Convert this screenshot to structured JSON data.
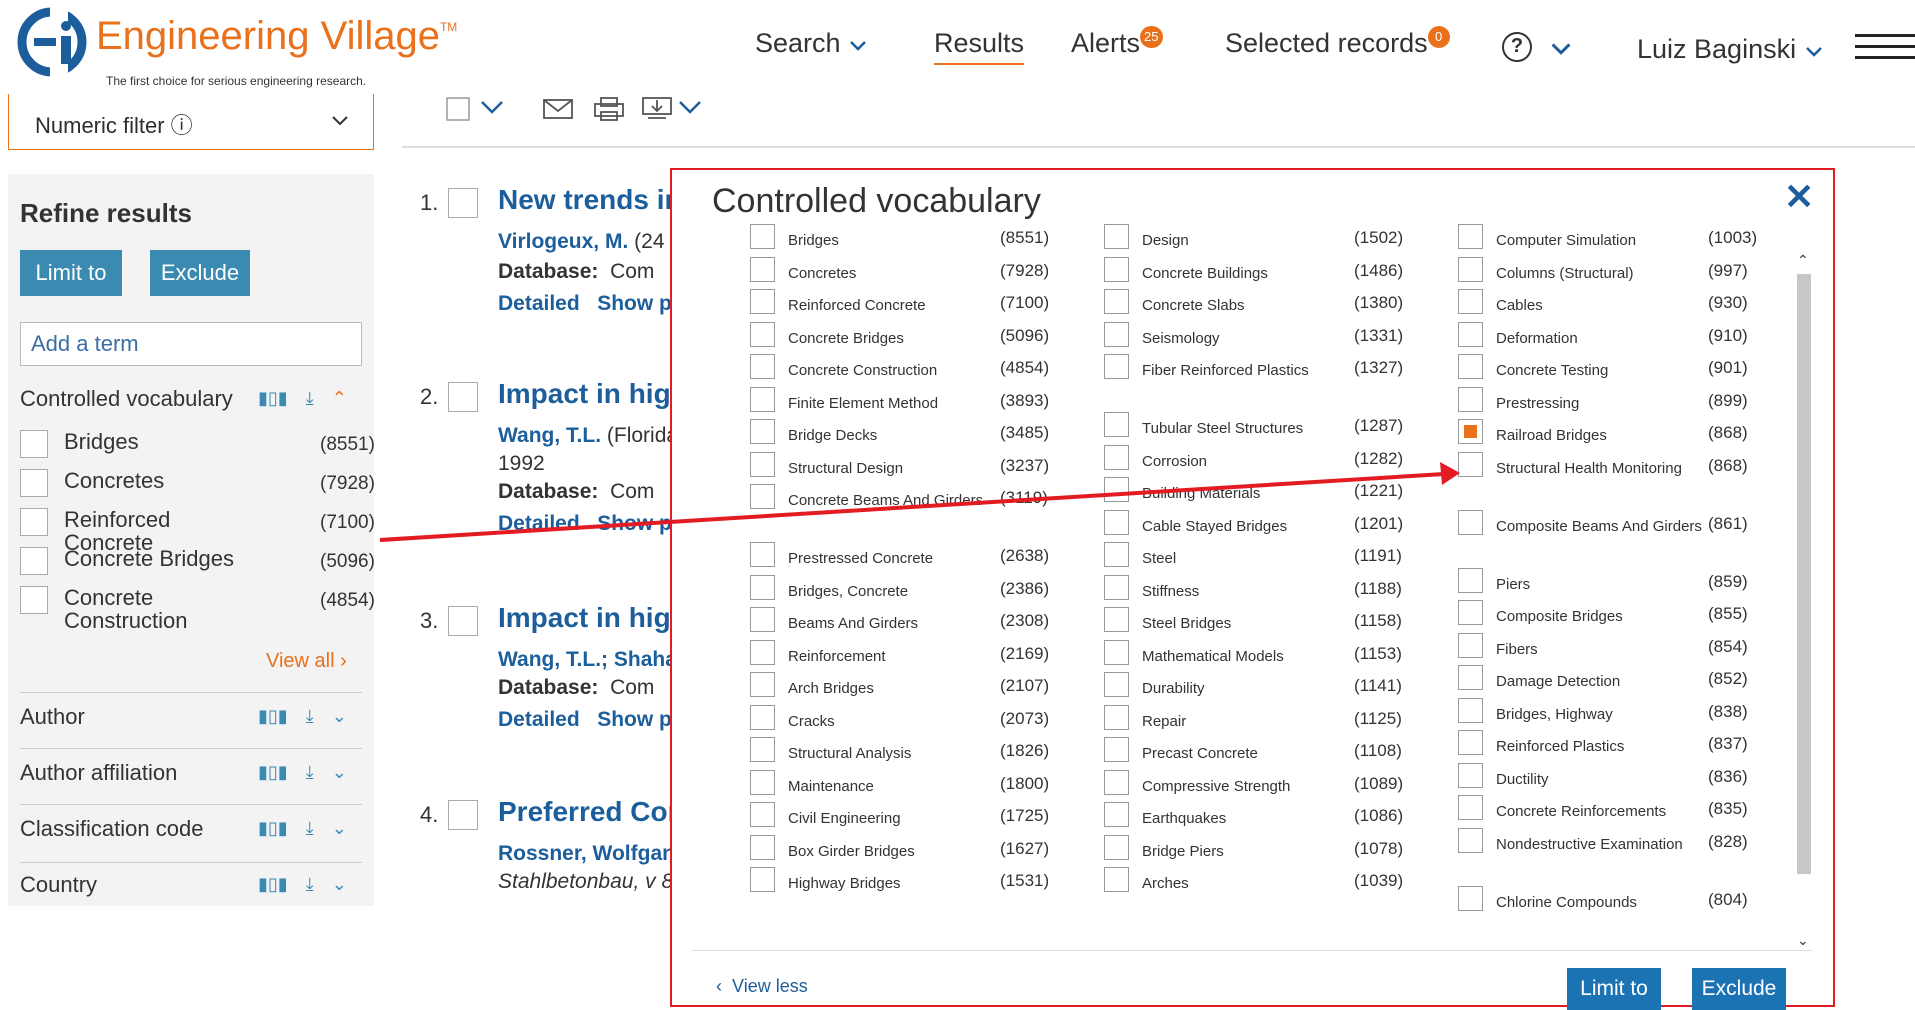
{
  "header": {
    "logo_title": "Engineering Village",
    "logo_tm": "TM",
    "logo_tagline": "The first choice for serious engineering research.",
    "nav_search": "Search",
    "nav_results": "Results",
    "nav_alerts": "Alerts",
    "alerts_badge": "25",
    "nav_selected": "Selected records",
    "selected_badge": "0",
    "help_symbol": "?",
    "user_name": "Luiz Baginski",
    "accent_color": "#e9711c"
  },
  "sidebar": {
    "numeric_filter": "Numeric filter ⓘ",
    "refine_title": "Refine results",
    "limit_label": "Limit to",
    "exclude_label": "Exclude",
    "add_term_placeholder": "Add a term",
    "controlled_vocab_label": "Controlled vocabulary",
    "items": [
      {
        "label": "Bridges",
        "count": "(8551)"
      },
      {
        "label": "Concretes",
        "count": "(7928)"
      },
      {
        "label": "Reinforced Concrete",
        "count": "(7100)"
      },
      {
        "label": "Concrete Bridges",
        "count": "(5096)"
      },
      {
        "label": "Concrete Construction",
        "count": "(4854)"
      }
    ],
    "view_all": "View all",
    "facets": [
      "Author",
      "Author affiliation",
      "Classification code",
      "Country"
    ]
  },
  "results": [
    {
      "num": "1.",
      "title": "New trends in",
      "line1_author": "Virlogeux, M.",
      "line1_rest": " (24",
      "db_label": "Database:",
      "db_value": "Com",
      "link1": "Detailed",
      "link2": "Show p"
    },
    {
      "num": "2.",
      "title": "Impact in high",
      "line1_author": "Wang, T.L.",
      "line1_rest": " (Florida",
      "year": "1992",
      "db_label": "Database:",
      "db_value": "Com",
      "link1": "Detailed",
      "link2": "Show p"
    },
    {
      "num": "3.",
      "title": "Impact in high",
      "line1_author": "Wang, T.L.; Shaha",
      "db_label": "Database:",
      "db_value": "Com",
      "link1": "Detailed",
      "link2": "Show p"
    },
    {
      "num": "4.",
      "title": "Preferred Con",
      "line1_author": "Rossner, Wolfgan",
      "line2": "Stahlbetonbau, v 8"
    }
  ],
  "modal": {
    "title": "Controlled vocabulary",
    "close": "✕",
    "view_less": "View less",
    "limit_label": "Limit to",
    "exclude_label": "Exclude",
    "col1": [
      {
        "label": "Bridges",
        "count": "(8551)"
      },
      {
        "label": "Concretes",
        "count": "(7928)"
      },
      {
        "label": "Reinforced Concrete",
        "count": "(7100)"
      },
      {
        "label": "Concrete Bridges",
        "count": "(5096)"
      },
      {
        "label": "Concrete Construction",
        "count": "(4854)"
      },
      {
        "label": "Finite Element Method",
        "count": "(3893)"
      },
      {
        "label": "Bridge Decks",
        "count": "(3485)"
      },
      {
        "label": "Structural Design",
        "count": "(3237)"
      },
      {
        "label": "Concrete Beams And Girders",
        "count": "(3119)"
      },
      {
        "label": "Prestressed Concrete",
        "count": "(2638)"
      },
      {
        "label": "Bridges, Concrete",
        "count": "(2386)"
      },
      {
        "label": "Beams And Girders",
        "count": "(2308)"
      },
      {
        "label": "Reinforcement",
        "count": "(2169)"
      },
      {
        "label": "Arch Bridges",
        "count": "(2107)"
      },
      {
        "label": "Cracks",
        "count": "(2073)"
      },
      {
        "label": "Structural Analysis",
        "count": "(1826)"
      },
      {
        "label": "Maintenance",
        "count": "(1800)"
      },
      {
        "label": "Civil Engineering",
        "count": "(1725)"
      },
      {
        "label": "Box Girder Bridges",
        "count": "(1627)"
      },
      {
        "label": "Highway Bridges",
        "count": "(1531)"
      }
    ],
    "col2": [
      {
        "label": "Design",
        "count": "(1502)"
      },
      {
        "label": "Concrete Buildings",
        "count": "(1486)"
      },
      {
        "label": "Concrete Slabs",
        "count": "(1380)"
      },
      {
        "label": "Seismology",
        "count": "(1331)"
      },
      {
        "label": "Fiber Reinforced Plastics",
        "count": "(1327)"
      },
      {
        "label": "Tubular Steel Structures",
        "count": "(1287)"
      },
      {
        "label": "Corrosion",
        "count": "(1282)"
      },
      {
        "label": "Building Materials",
        "count": "(1221)"
      },
      {
        "label": "Cable Stayed Bridges",
        "count": "(1201)"
      },
      {
        "label": "Steel",
        "count": "(1191)"
      },
      {
        "label": "Stiffness",
        "count": "(1188)"
      },
      {
        "label": "Steel Bridges",
        "count": "(1158)"
      },
      {
        "label": "Mathematical Models",
        "count": "(1153)"
      },
      {
        "label": "Durability",
        "count": "(1141)"
      },
      {
        "label": "Repair",
        "count": "(1125)"
      },
      {
        "label": "Precast Concrete",
        "count": "(1108)"
      },
      {
        "label": "Compressive Strength",
        "count": "(1089)"
      },
      {
        "label": "Earthquakes",
        "count": "(1086)"
      },
      {
        "label": "Bridge Piers",
        "count": "(1078)"
      },
      {
        "label": "Arches",
        "count": "(1039)"
      }
    ],
    "col3": [
      {
        "label": "Computer Simulation",
        "count": "(1003)"
      },
      {
        "label": "Columns (Structural)",
        "count": "(997)"
      },
      {
        "label": "Cables",
        "count": "(930)"
      },
      {
        "label": "Deformation",
        "count": "(910)"
      },
      {
        "label": "Concrete Testing",
        "count": "(901)"
      },
      {
        "label": "Prestressing",
        "count": "(899)"
      },
      {
        "label": "Railroad Bridges",
        "count": "(868)",
        "checked": true
      },
      {
        "label": "Structural Health Monitoring",
        "count": "(868)"
      },
      {
        "label": "Composite Beams And Girders",
        "count": "(861)"
      },
      {
        "label": "Piers",
        "count": "(859)"
      },
      {
        "label": "Composite Bridges",
        "count": "(855)"
      },
      {
        "label": "Fibers",
        "count": "(854)"
      },
      {
        "label": "Damage Detection",
        "count": "(852)"
      },
      {
        "label": "Bridges, Highway",
        "count": "(838)"
      },
      {
        "label": "Reinforced Plastics",
        "count": "(837)"
      },
      {
        "label": "Ductility",
        "count": "(836)"
      },
      {
        "label": "Concrete Reinforcements",
        "count": "(835)"
      },
      {
        "label": "Nondestructive Examination",
        "count": "(828)"
      },
      {
        "label": "Chlorine Compounds",
        "count": "(804)"
      }
    ]
  }
}
